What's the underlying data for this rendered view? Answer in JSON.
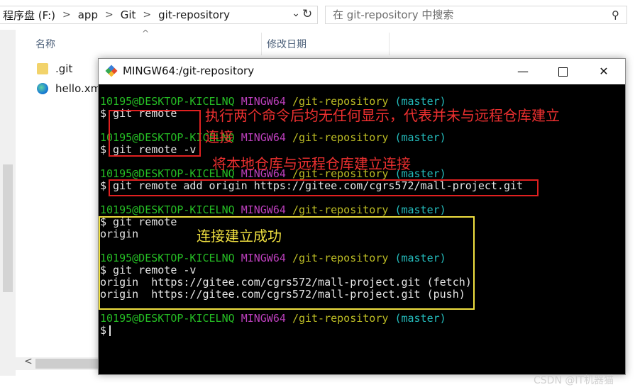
{
  "explorer": {
    "breadcrumbs": [
      "程序盘 (F:)",
      "app",
      "Git",
      "git-repository"
    ],
    "search_placeholder": "在 git-repository 中搜索",
    "columns": {
      "name": "名称",
      "modified": "修改日期"
    },
    "files": [
      {
        "name": ".git",
        "icon": "folder-icon"
      },
      {
        "name": "hello.xml",
        "icon": "edge-icon"
      }
    ]
  },
  "terminal": {
    "title": "MINGW64:/git-repository",
    "prompt": {
      "user": "10195@DESKTOP-KICELNQ",
      "system": "MINGW64",
      "path": "/git-repository",
      "branch": "(master)"
    },
    "commands": [
      "$ git remote",
      "$ git remote -v",
      "$ git remote add origin https://gitee.com/cgrs572/mall-project.git",
      "$ git remote",
      "$ git remote -v",
      "$"
    ],
    "outputs": [
      "origin",
      "origin  https://gitee.com/cgrs572/mall-project.git (fetch)",
      "origin  https://gitee.com/cgrs572/mall-project.git (push)"
    ]
  },
  "annotations": {
    "no_output_line1": "执行两个命令后均无任何显示，代表并未与远程仓库建立",
    "no_output_line2": "连接",
    "link_local": "将本地仓库与远程仓库建立连接",
    "success": "连接建立成功"
  },
  "watermark": "CSDN @IT机器猫",
  "colors": {
    "prompt_user": "#25bc24",
    "prompt_system": "#bc3fbc",
    "prompt_path": "#bcbc24",
    "prompt_branch": "#24bcbc",
    "annotation_red": "#e02020",
    "annotation_yellow": "#f0e040"
  }
}
